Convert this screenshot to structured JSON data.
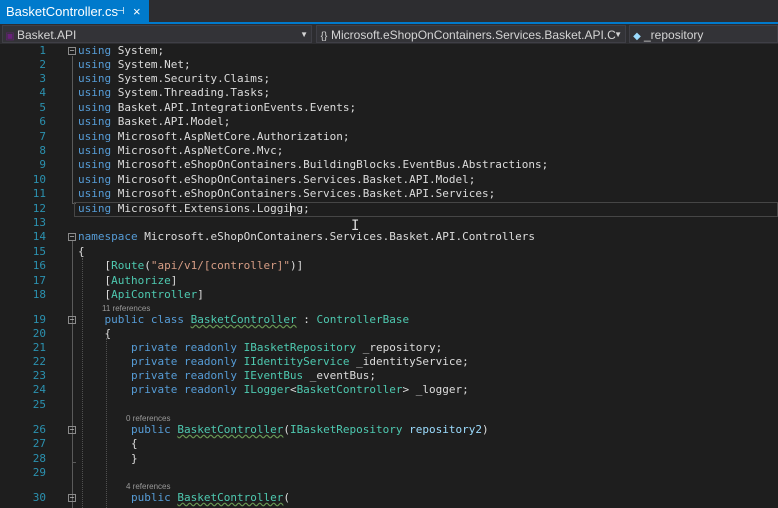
{
  "tab": {
    "title": "BasketController.cs",
    "pin_icon": "pin-icon",
    "close_glyph": "×"
  },
  "nav": {
    "project": "Basket.API",
    "type_scope": "Microsoft.eShopOnContainers.Services.Basket.API.C",
    "member": "_repository"
  },
  "lines": [
    {
      "n": "1",
      "t": "using System;"
    },
    {
      "n": "2",
      "t": "using System.Net;"
    },
    {
      "n": "3",
      "t": "using System.Security.Claims;"
    },
    {
      "n": "4",
      "t": "using System.Threading.Tasks;"
    },
    {
      "n": "5",
      "t": "using Basket.API.IntegrationEvents.Events;"
    },
    {
      "n": "6",
      "t": "using Basket.API.Model;"
    },
    {
      "n": "7",
      "t": "using Microsoft.AspNetCore.Authorization;"
    },
    {
      "n": "8",
      "t": "using Microsoft.AspNetCore.Mvc;"
    },
    {
      "n": "9",
      "t": "using Microsoft.eShopOnContainers.BuildingBlocks.EventBus.Abstractions;"
    },
    {
      "n": "10",
      "t": "using Microsoft.eShopOnContainers.Services.Basket.API.Model;"
    },
    {
      "n": "11",
      "t": "using Microsoft.eShopOnContainers.Services.Basket.API.Services;"
    },
    {
      "n": "12",
      "t": "using Microsoft.Extensions.Logging;"
    },
    {
      "n": "13",
      "t": ""
    },
    {
      "n": "14",
      "t": "namespace Microsoft.eShopOnContainers.Services.Basket.API.Controllers"
    },
    {
      "n": "15",
      "t": "{"
    },
    {
      "n": "16",
      "t": "    [Route(\"api/v1/[controller]\")]"
    },
    {
      "n": "17",
      "t": "    [Authorize]"
    },
    {
      "n": "18",
      "t": "    [ApiController]"
    },
    {
      "n": "19",
      "t": "    public class BasketController : ControllerBase"
    },
    {
      "n": "20",
      "t": "    {"
    },
    {
      "n": "21",
      "t": "        private readonly IBasketRepository _repository;"
    },
    {
      "n": "22",
      "t": "        private readonly IIdentityService _identityService;"
    },
    {
      "n": "23",
      "t": "        private readonly IEventBus _eventBus;"
    },
    {
      "n": "24",
      "t": "        private readonly ILogger<BasketController> _logger;"
    },
    {
      "n": "25",
      "t": ""
    },
    {
      "n": "26",
      "t": "        public BasketController(IBasketRepository repository2)"
    },
    {
      "n": "27",
      "t": "        {"
    },
    {
      "n": "28",
      "t": "        }"
    },
    {
      "n": "29",
      "t": ""
    },
    {
      "n": "30",
      "t": "        public BasketController("
    }
  ],
  "lenses": {
    "class_refs": "11 references",
    "ctor1_refs": "0 references",
    "ctor2_refs": "4 references"
  }
}
